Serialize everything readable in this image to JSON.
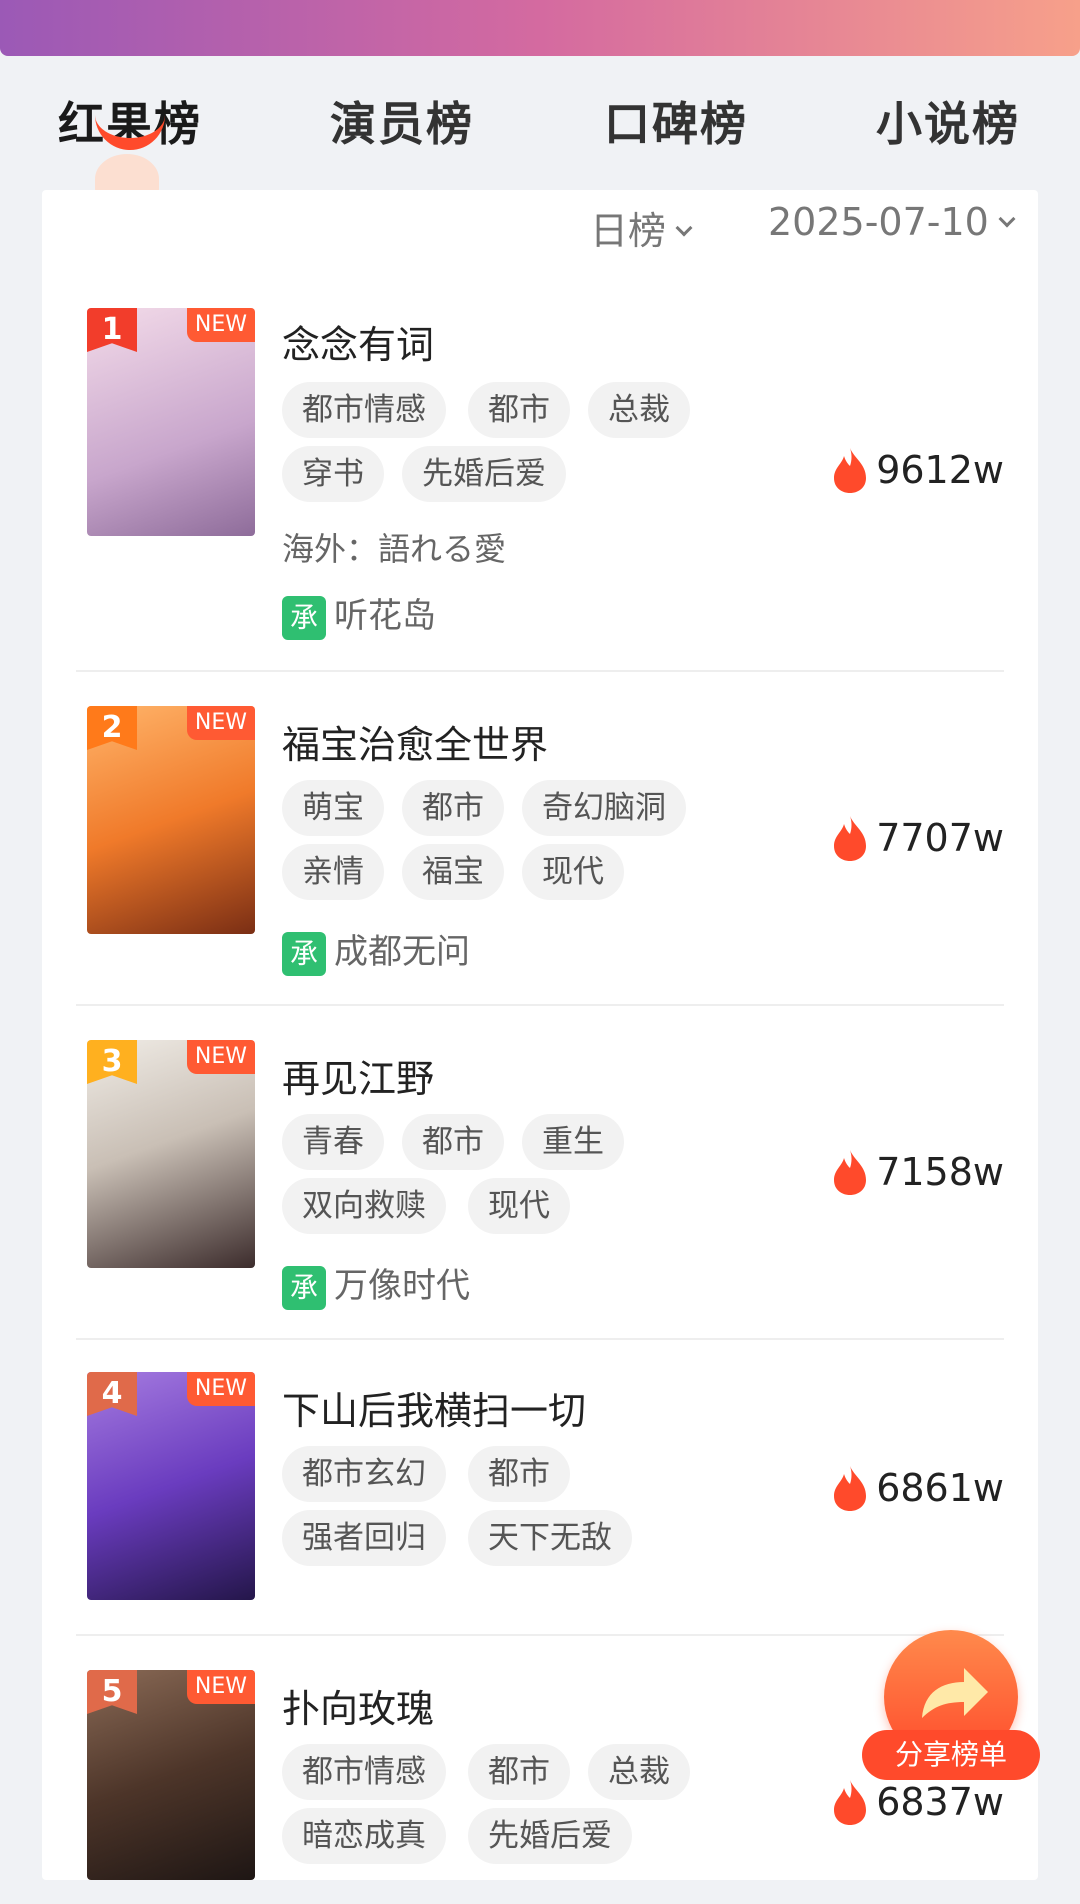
{
  "tabs": [
    {
      "label": "红果榜",
      "active": true
    },
    {
      "label": "演员榜",
      "active": false
    },
    {
      "label": "口碑榜",
      "active": false
    },
    {
      "label": "小说榜",
      "active": false
    }
  ],
  "filters": {
    "period": "日榜",
    "date": "2025-07-10"
  },
  "new_label": "NEW",
  "producer_badge": "承",
  "items": [
    {
      "rank": "1",
      "rank_color": "#f23d2b",
      "title": "念念有词",
      "tags": [
        "都市情感",
        "都市",
        "总裁",
        "穿书",
        "先婚后爱"
      ],
      "overseas": "海外：語れる愛",
      "producer": "听花岛",
      "heat": "9612w",
      "poster_colors": [
        "#f1d6e6",
        "#c7a2c8"
      ]
    },
    {
      "rank": "2",
      "rank_color": "#ff7a1a",
      "title": "福宝治愈全世界",
      "tags": [
        "萌宝",
        "都市",
        "奇幻脑洞",
        "亲情",
        "福宝",
        "现代"
      ],
      "overseas": "",
      "producer": "成都无问",
      "heat": "7707w",
      "poster_colors": [
        "#f28a2e",
        "#8e3b1a"
      ]
    },
    {
      "rank": "3",
      "rank_color": "#ffb01f",
      "title": "再见江野",
      "tags": [
        "青春",
        "都市",
        "重生",
        "双向救赎",
        "现代"
      ],
      "overseas": "",
      "producer": "万像时代",
      "heat": "7158w",
      "poster_colors": [
        "#d9d3cc",
        "#4a3a3a"
      ]
    },
    {
      "rank": "4",
      "rank_color": "#e06a4a",
      "title": "下山后我横扫一切",
      "tags": [
        "都市玄幻",
        "都市",
        "强者回归",
        "天下无敌"
      ],
      "overseas": "",
      "producer": "",
      "heat": "6861w",
      "poster_colors": [
        "#6a3cbf",
        "#24164a"
      ]
    },
    {
      "rank": "5",
      "rank_color": "#e06a4a",
      "title": "扑向玫瑰",
      "tags": [
        "都市情感",
        "都市",
        "总裁",
        "暗恋成真",
        "先婚后爱"
      ],
      "overseas": "",
      "producer": "",
      "heat": "6837w",
      "poster_colors": [
        "#6b4d3e",
        "#1e1614"
      ]
    }
  ],
  "share_button": "分享榜单",
  "colors": {
    "accent": "#ff4a2b",
    "flame": "#ff4a2b",
    "producer_badge": "#2fbf71"
  }
}
